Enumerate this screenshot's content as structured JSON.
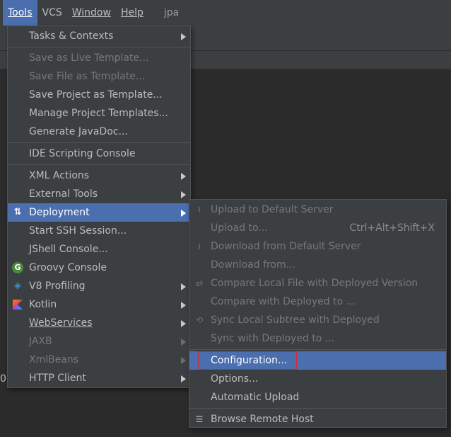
{
  "menubar": {
    "items": [
      {
        "label": "Tools",
        "active": true
      },
      {
        "label": "VCS",
        "active": false
      },
      {
        "label": "Window",
        "active": false
      },
      {
        "label": "Help",
        "active": false
      }
    ],
    "project": "jpa"
  },
  "editor": {
    "line_stub": "0"
  },
  "tools_menu": {
    "items": [
      {
        "label": "Tasks & Contexts",
        "submenu": true
      },
      {
        "label": "Save as Live Template...",
        "disabled": true
      },
      {
        "label": "Save File as Template...",
        "disabled": true
      },
      {
        "label": "Save Project as Template..."
      },
      {
        "label": "Manage Project Templates..."
      },
      {
        "label": "Generate JavaDoc..."
      },
      {
        "label": "IDE Scripting Console"
      },
      {
        "label": "XML Actions",
        "submenu": true
      },
      {
        "label": "External Tools",
        "submenu": true
      },
      {
        "label": "Deployment",
        "submenu": true,
        "selected": true,
        "icon": "deployment-arrows-icon"
      },
      {
        "label": "Start SSH Session..."
      },
      {
        "label": "JShell Console..."
      },
      {
        "label": "Groovy Console",
        "icon": "groovy-icon"
      },
      {
        "label": "V8 Profiling",
        "submenu": true,
        "icon": "v8-icon"
      },
      {
        "label": "Kotlin",
        "submenu": true,
        "icon": "kotlin-icon"
      },
      {
        "label": "WebServices",
        "submenu": true
      },
      {
        "label": "JAXB",
        "submenu": true,
        "disabled": true
      },
      {
        "label": "XmlBeans",
        "submenu": true,
        "disabled": true
      },
      {
        "label": "HTTP Client",
        "submenu": true
      }
    ]
  },
  "deployment_menu": {
    "items": [
      {
        "label": "Upload to Default Server",
        "disabled": true,
        "icon": "upload-icon"
      },
      {
        "label": "Upload to...",
        "disabled": true,
        "shortcut": "Ctrl+Alt+Shift+X"
      },
      {
        "label": "Download from Default Server",
        "disabled": true,
        "icon": "download-icon"
      },
      {
        "label": "Download from...",
        "disabled": true
      },
      {
        "label": "Compare Local File with Deployed Version",
        "disabled": true,
        "icon": "compare-icon"
      },
      {
        "label": "Compare with Deployed to ...",
        "disabled": true
      },
      {
        "label": "Sync Local Subtree with Deployed",
        "disabled": true,
        "icon": "sync-icon"
      },
      {
        "label": "Sync with Deployed to ...",
        "disabled": true
      },
      {
        "label": "Configuration...",
        "selected": true,
        "highlighted_box": true
      },
      {
        "label": "Options..."
      },
      {
        "label": "Automatic Upload"
      },
      {
        "label": "Browse Remote Host",
        "icon": "browse-remote-host-icon"
      }
    ]
  },
  "colors": {
    "menu_bg": "#3c3f41",
    "selection": "#4b6eaf",
    "highlight_box": "#d9272e",
    "text": "#bbbbbb",
    "disabled_text": "#777777"
  }
}
